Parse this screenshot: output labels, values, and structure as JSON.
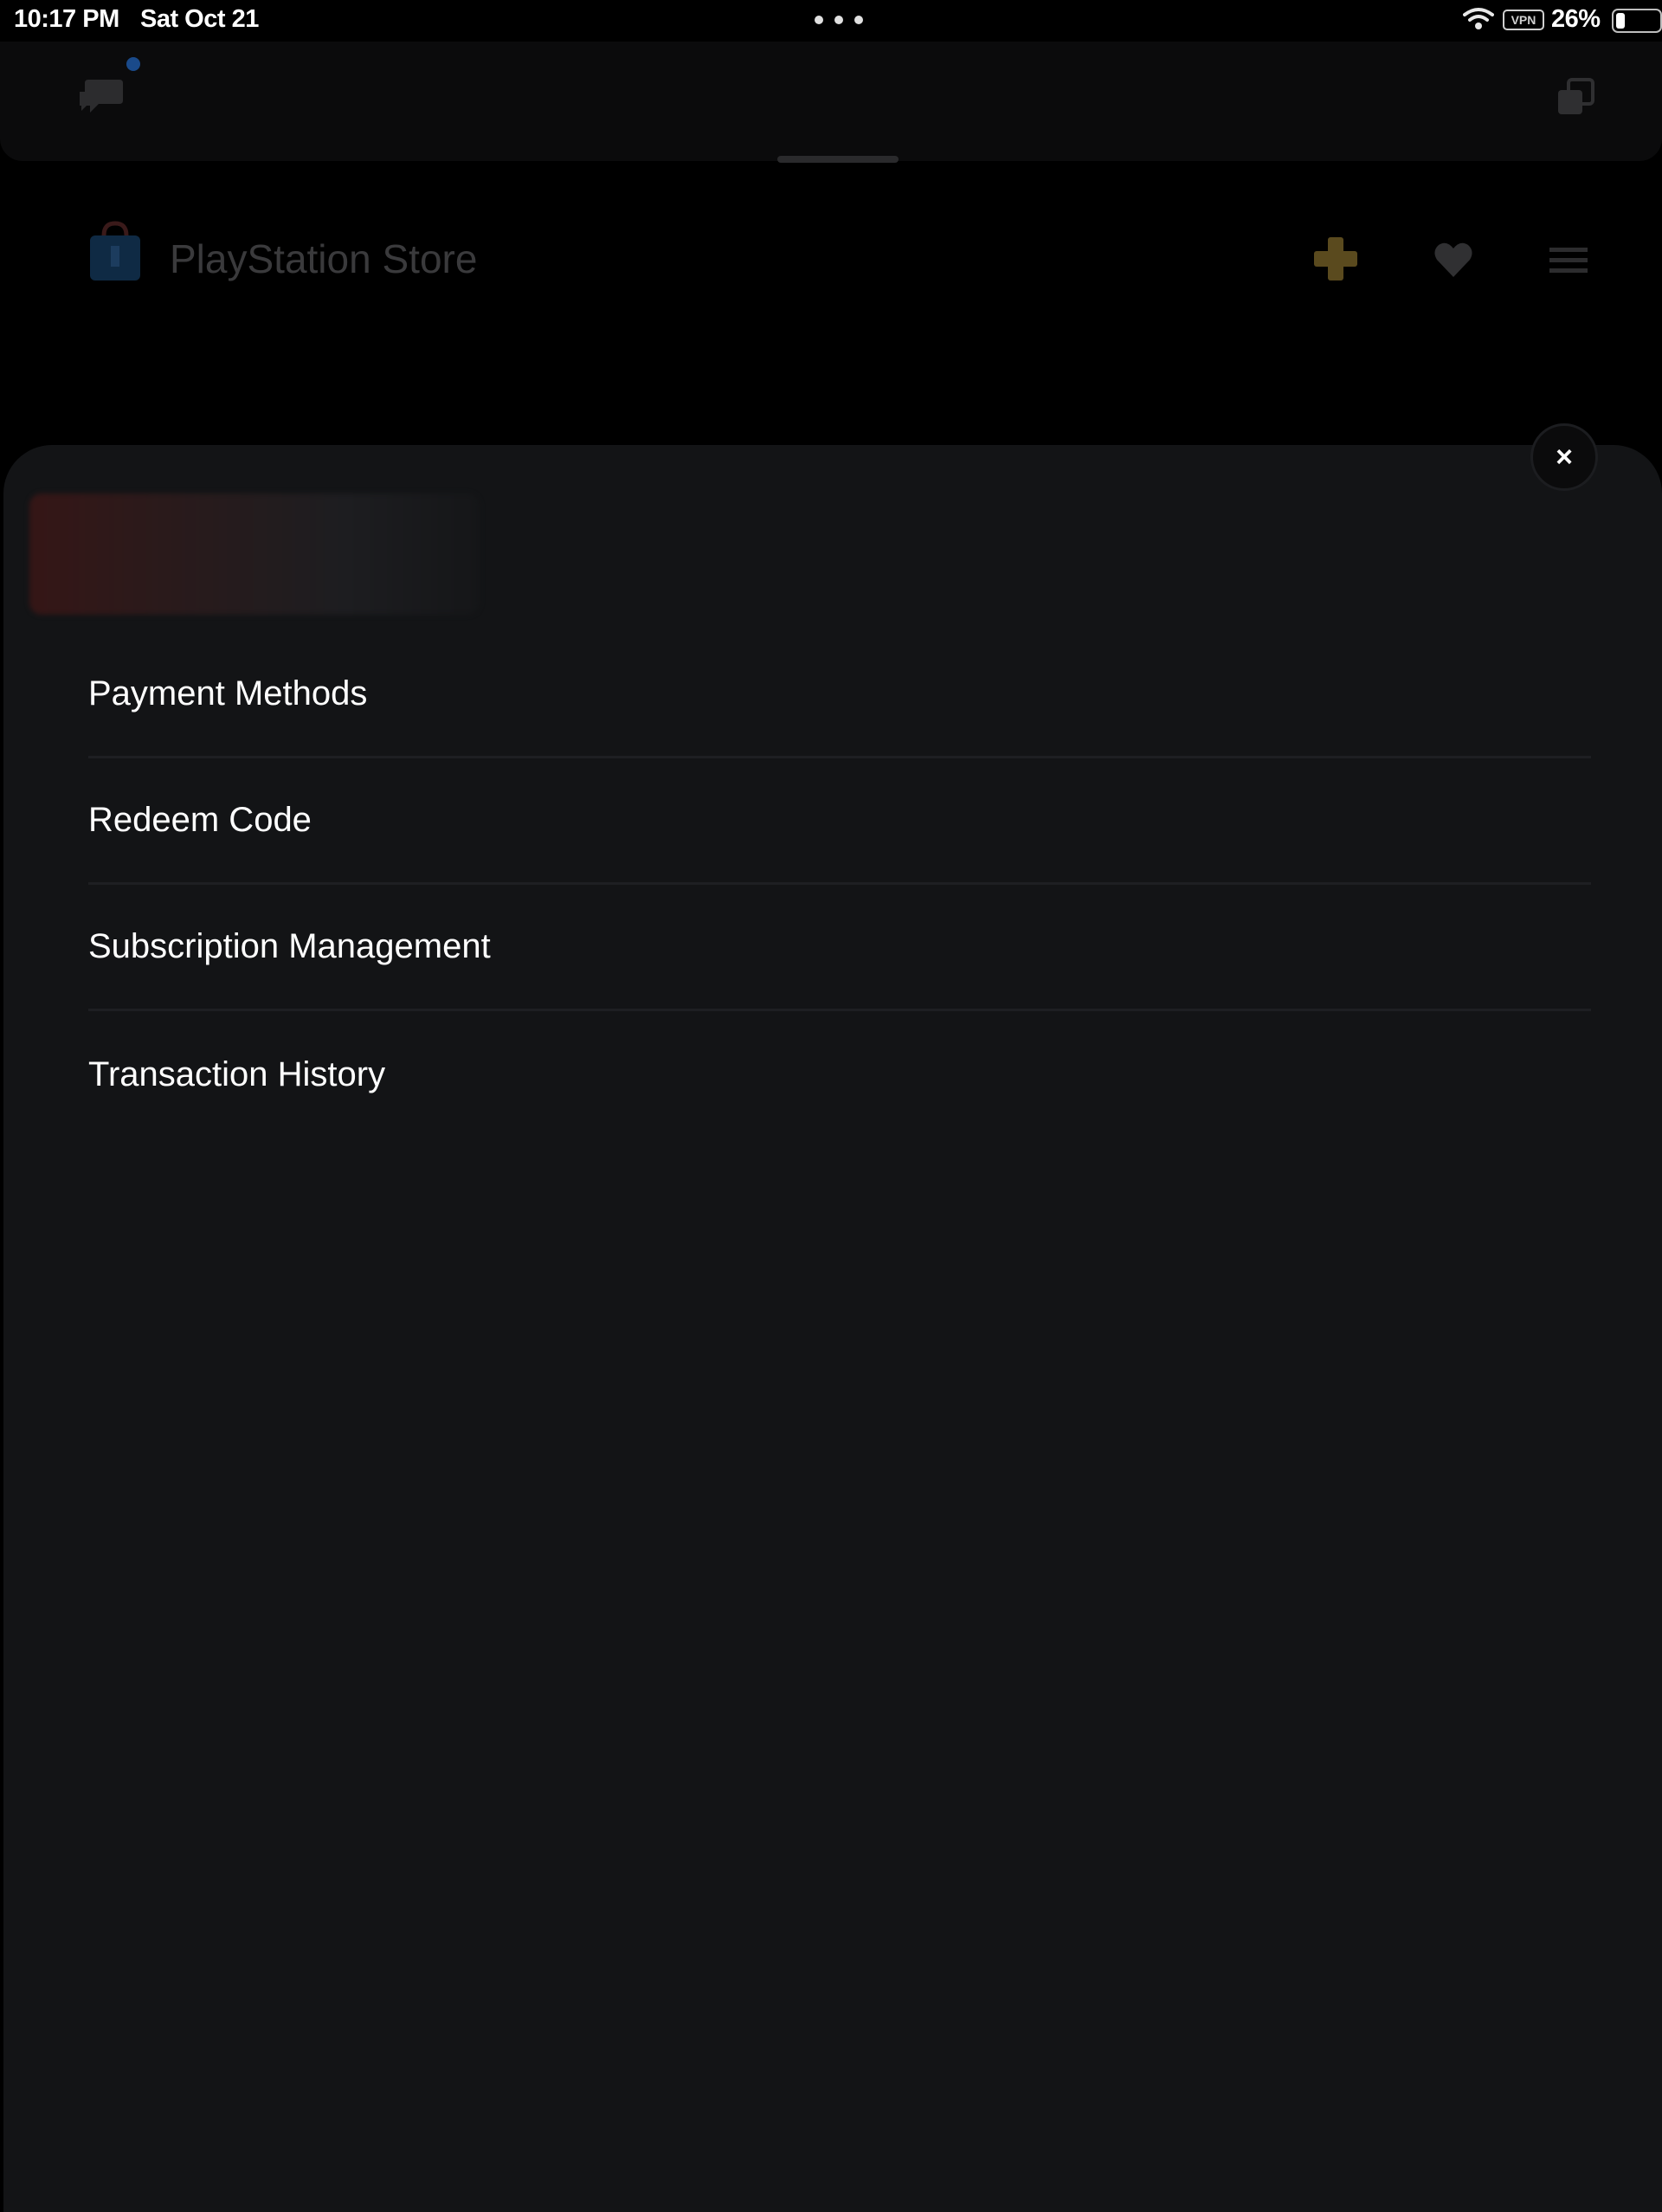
{
  "status_bar": {
    "time": "10:17 PM",
    "date": "Sat Oct 21",
    "vpn": "VPN",
    "battery": "26%"
  },
  "store": {
    "title": "PlayStation Store"
  },
  "close_label": "×",
  "menu": [
    {
      "label": "Payment Methods"
    },
    {
      "label": "Redeem Code"
    },
    {
      "label": "Subscription Management"
    },
    {
      "label": "Transaction History"
    }
  ],
  "colors": {
    "sheet_bg": "#131416",
    "page_bg": "#000000",
    "divider": "#1e1f22",
    "plus_accent": "#5a4a1e"
  }
}
